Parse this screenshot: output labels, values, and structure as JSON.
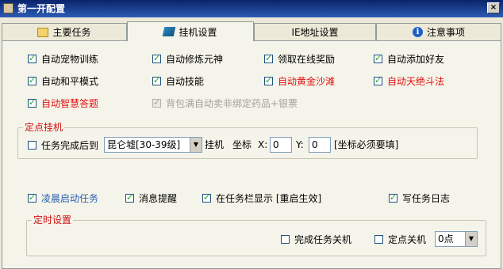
{
  "window": {
    "title": "第一开配置",
    "close_label": "×"
  },
  "tabs": [
    {
      "label": "主要任务",
      "icon": "folder-icon"
    },
    {
      "label": "挂机设置",
      "icon": "plugin-icon"
    },
    {
      "label": "IE地址设置",
      "icon": ""
    },
    {
      "label": "注意事项",
      "icon": "info-icon"
    }
  ],
  "options": {
    "r1": [
      "自动宠物训练",
      "自动修炼元神",
      "领取在线奖励",
      "自动添加好友"
    ],
    "r2": [
      "自动和平模式",
      "自动技能",
      "自动黄金沙滩",
      "自动天绝斗法"
    ],
    "r3": [
      "自动智慧答题",
      "背包满自动卖非绑定药品+银票"
    ]
  },
  "fixed_point": {
    "legend": "定点挂机",
    "checkbox_label": "任务完成后到",
    "location_value": "昆仑墟[30-39级]",
    "after_select": "挂机",
    "coord_label": "坐标",
    "x_label": "X:",
    "x_value": "0",
    "y_label": "Y:",
    "y_value": "0",
    "note": "[坐标必须要填]"
  },
  "misc": [
    "凌晨启动任务",
    "消息提醒",
    "在任务栏显示 [重启生效]",
    "写任务日志"
  ],
  "timer": {
    "legend": "定时设置",
    "shutdown_label": "完成任务关机",
    "fixed_shutdown_label": "定点关机",
    "hour_value": "0点"
  }
}
